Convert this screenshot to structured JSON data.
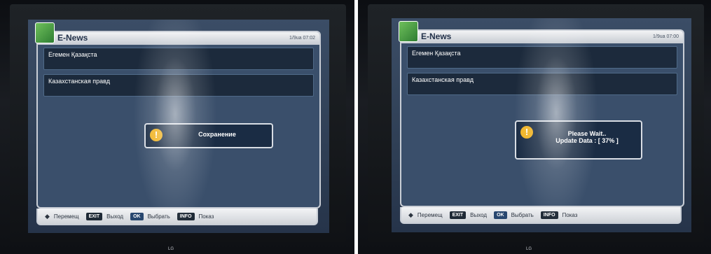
{
  "screens": [
    {
      "app": {
        "title": "E-News",
        "clock": "1/9ua 07:02"
      },
      "list": [
        {
          "label": "Егемен Қазақста"
        },
        {
          "label": "Казахстанская правд"
        }
      ],
      "dialog": {
        "icon": "warning-icon",
        "lines": [
          "Сохранение"
        ]
      },
      "footer": {
        "move": "Перемещ",
        "exit_key": "EXIT",
        "exit_label": "Выход",
        "ok_key": "OK",
        "ok_label": "Выбрать",
        "info_key": "INFO",
        "info_label": "Показ"
      },
      "tv_logo": "LG"
    },
    {
      "app": {
        "title": "E-News",
        "clock": "1/9ua 07:00"
      },
      "list": [
        {
          "label": "Егемен Қазақста"
        },
        {
          "label": "Казахстанская правд"
        }
      ],
      "dialog": {
        "icon": "warning-icon",
        "lines": [
          "Please Wait..",
          "Update Data : [ 37% ]"
        ]
      },
      "footer": {
        "move": "Перемещ",
        "exit_key": "EXIT",
        "exit_label": "Выход",
        "ok_key": "OK",
        "ok_label": "Выбрать",
        "info_key": "INFO",
        "info_label": "Показ"
      },
      "tv_logo": "LG"
    }
  ]
}
